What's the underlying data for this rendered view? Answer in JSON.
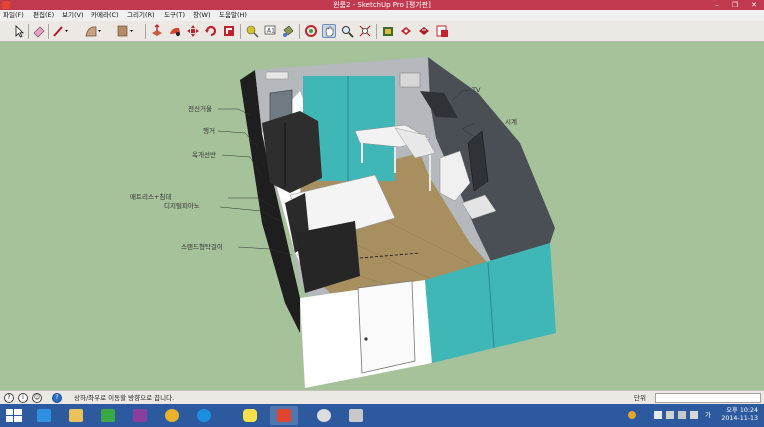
{
  "window": {
    "title": "윈룸2 - SketchUp Pro [평가판]",
    "minimize_glyph": "–",
    "maximize_glyph": "❐",
    "close_glyph": "✕"
  },
  "menubar": {
    "items": [
      {
        "label": "파일(F)"
      },
      {
        "label": "편집(E)"
      },
      {
        "label": "보기(V)"
      },
      {
        "label": "카메라(C)"
      },
      {
        "label": "그리기(R)"
      },
      {
        "label": "도구(T)"
      },
      {
        "label": "창(W)"
      },
      {
        "label": "도움말(H)"
      }
    ]
  },
  "toolbar": {
    "tools": [
      {
        "name": "select-tool-icon"
      },
      {
        "name": "eraser-tool-icon"
      },
      {
        "name": "line-tool-icon"
      },
      {
        "name": "arc-tool-icon"
      },
      {
        "name": "shape-tool-icon"
      },
      {
        "name": "push-pull-tool-icon"
      },
      {
        "name": "follow-me-tool-icon"
      },
      {
        "name": "move-tool-icon"
      },
      {
        "name": "rotate-tool-icon"
      },
      {
        "name": "scale-tool-icon"
      },
      {
        "name": "tape-measure-tool-icon"
      },
      {
        "name": "text-tool-icon"
      },
      {
        "name": "paint-bucket-tool-icon"
      },
      {
        "name": "orbit-tool-icon"
      },
      {
        "name": "pan-tool-icon"
      },
      {
        "name": "zoom-tool-icon"
      },
      {
        "name": "zoom-extents-tool-icon"
      },
      {
        "name": "warehouse-icon"
      },
      {
        "name": "extension-warehouse-icon"
      },
      {
        "name": "share-model-icon"
      },
      {
        "name": "layout-icon"
      }
    ]
  },
  "scene": {
    "labels": {
      "mirror": "전신거울",
      "hanger": "행거",
      "shelf": "옥개선반",
      "bed": "매트리스+침대",
      "piano": "디지털피아노",
      "stand_rack": "스탠드형탁걸이",
      "tv": "TV",
      "clock": "시계"
    }
  },
  "statusbar": {
    "text": "상하/좌우로 이동할 방향으로 끕니다.",
    "units_label": "단위",
    "measure_value": ""
  },
  "taskbar": {
    "tray_ime": "가",
    "time": "오후 10:24",
    "date": "2014-11-13"
  },
  "colors": {
    "background": "#a5c29b",
    "title_bar": "#c0394f",
    "taskbar": "#2d5a9e",
    "glass": "#3fb7b6",
    "floor": "#a88f60"
  }
}
